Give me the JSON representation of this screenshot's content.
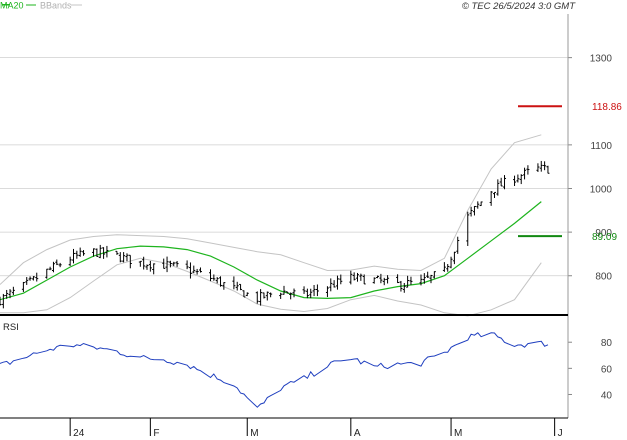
{
  "header": {
    "legend_ma": "MA20",
    "legend_bbands": "BBands",
    "copyright": "© TEC 26/5/2024 3:0 GMT"
  },
  "colors": {
    "background": "#ffffff",
    "grid": "#cfcfcf",
    "price": "#000000",
    "ma20": "#1eb41e",
    "bbands": "#c4c4c4",
    "rsi": "#1f3fbf",
    "resistance": "#cc1111",
    "support": "#118811"
  },
  "chart_data": [
    {
      "type": "ohlc",
      "title": "",
      "y_ticks": [
        {
          "value": 130,
          "label": "1300"
        },
        {
          "value": 110,
          "label": "1100"
        },
        {
          "value": 100,
          "label": "1000"
        },
        {
          "value": 90,
          "label": "900"
        },
        {
          "value": 80,
          "label": "800"
        }
      ],
      "ylim": [
        71,
        140
      ],
      "x_ticks": [
        {
          "date": "2024-01-08",
          "label": "24"
        },
        {
          "date": "2024-02-01",
          "label": "F"
        },
        {
          "date": "2024-03-01",
          "label": "M"
        },
        {
          "date": "2024-04-01",
          "label": "A"
        },
        {
          "date": "2024-05-01",
          "label": "M"
        },
        {
          "date": "2024-06-01",
          "label": "J"
        }
      ],
      "x_range": [
        "2023-12-18",
        "2024-06-05"
      ],
      "grid": "horizontal",
      "legend": "top-left",
      "series": [
        {
          "name": "MA20",
          "kind": "line",
          "color": "#1eb41e",
          "points": [
            [
              "2023-12-18",
              74.5
            ],
            [
              "2023-12-25",
              76
            ],
            [
              "2024-01-01",
              79
            ],
            [
              "2024-01-08",
              82
            ],
            [
              "2024-01-15",
              84.5
            ],
            [
              "2024-01-22",
              86.2
            ],
            [
              "2024-01-29",
              86.8
            ],
            [
              "2024-02-05",
              86.6
            ],
            [
              "2024-02-12",
              86
            ],
            [
              "2024-02-19",
              84.5
            ],
            [
              "2024-02-26",
              82
            ],
            [
              "2024-03-04",
              79
            ],
            [
              "2024-03-11",
              76.5
            ],
            [
              "2024-03-18",
              75
            ],
            [
              "2024-03-25",
              74.8
            ],
            [
              "2024-04-01",
              75
            ],
            [
              "2024-04-08",
              76.5
            ],
            [
              "2024-04-15",
              77.5
            ],
            [
              "2024-04-22",
              78.2
            ],
            [
              "2024-04-29",
              80
            ],
            [
              "2024-05-06",
              84
            ],
            [
              "2024-05-13",
              88
            ],
            [
              "2024-05-20",
              92
            ],
            [
              "2024-05-28",
              97
            ]
          ]
        },
        {
          "name": "BBands upper",
          "kind": "line",
          "color": "#c4c4c4",
          "points": [
            [
              "2023-12-18",
              78
            ],
            [
              "2023-12-25",
              83
            ],
            [
              "2024-01-01",
              86
            ],
            [
              "2024-01-08",
              88.2
            ],
            [
              "2024-01-15",
              89
            ],
            [
              "2024-01-22",
              89.4
            ],
            [
              "2024-01-29",
              89.2
            ],
            [
              "2024-02-05",
              89
            ],
            [
              "2024-02-12",
              88.5
            ],
            [
              "2024-02-19",
              87.5
            ],
            [
              "2024-02-26",
              86.5
            ],
            [
              "2024-03-04",
              85.5
            ],
            [
              "2024-03-11",
              84.8
            ],
            [
              "2024-03-18",
              83
            ],
            [
              "2024-03-25",
              81.2
            ],
            [
              "2024-04-01",
              81.3
            ],
            [
              "2024-04-08",
              82.2
            ],
            [
              "2024-04-15",
              81.5
            ],
            [
              "2024-04-22",
              81.2
            ],
            [
              "2024-04-29",
              84
            ],
            [
              "2024-05-06",
              95
            ],
            [
              "2024-05-13",
              104.5
            ],
            [
              "2024-05-20",
              110.5
            ],
            [
              "2024-05-28",
              112.3
            ]
          ]
        },
        {
          "name": "BBands lower",
          "kind": "line",
          "color": "#c4c4c4",
          "points": [
            [
              "2023-12-18",
              71.5
            ],
            [
              "2023-12-25",
              71.5
            ],
            [
              "2024-01-01",
              72.2
            ],
            [
              "2024-01-08",
              75
            ],
            [
              "2024-01-15",
              78.8
            ],
            [
              "2024-01-22",
              82.5
            ],
            [
              "2024-01-29",
              84
            ],
            [
              "2024-02-05",
              83
            ],
            [
              "2024-02-12",
              81
            ],
            [
              "2024-02-19",
              78.8
            ],
            [
              "2024-02-26",
              76.5
            ],
            [
              "2024-03-04",
              73.5
            ],
            [
              "2024-03-11",
              72.3
            ],
            [
              "2024-03-18",
              71.8
            ],
            [
              "2024-03-25",
              72.5
            ],
            [
              "2024-04-01",
              74.5
            ],
            [
              "2024-04-08",
              75.5
            ],
            [
              "2024-04-15",
              74.2
            ],
            [
              "2024-04-22",
              73.3
            ],
            [
              "2024-04-29",
              71.5
            ],
            [
              "2024-05-06",
              70.8
            ],
            [
              "2024-05-13",
              72.2
            ],
            [
              "2024-05-20",
              74.5
            ],
            [
              "2024-05-28",
              83
            ]
          ]
        },
        {
          "name": "Price",
          "kind": "ohlc",
          "color": "#000000",
          "points": [
            [
              "2023-12-18",
              74.5
            ],
            [
              "2023-12-25",
              77.5
            ],
            [
              "2024-01-01",
              81
            ],
            [
              "2024-01-08",
              84
            ],
            [
              "2024-01-15",
              85.5
            ],
            [
              "2024-01-22",
              84.5
            ],
            [
              "2024-01-29",
              83
            ],
            [
              "2024-02-05",
              82.5
            ],
            [
              "2024-02-12",
              81.5
            ],
            [
              "2024-02-19",
              79.5
            ],
            [
              "2024-02-26",
              77
            ],
            [
              "2024-03-04",
              74.8
            ],
            [
              "2024-03-11",
              76.5
            ],
            [
              "2024-03-18",
              75.5
            ],
            [
              "2024-03-25",
              77.5
            ],
            [
              "2024-04-01",
              79.5
            ],
            [
              "2024-04-08",
              79
            ],
            [
              "2024-04-15",
              78
            ],
            [
              "2024-04-22",
              78.5
            ],
            [
              "2024-04-29",
              81
            ],
            [
              "2024-05-06",
              93.5
            ],
            [
              "2024-05-13",
              99.5
            ],
            [
              "2024-05-20",
              102.5
            ],
            [
              "2024-05-27",
              104.5
            ]
          ]
        }
      ],
      "levels": [
        {
          "name": "resistance",
          "value": 118.86,
          "label": "118.86",
          "color": "#cc1111"
        },
        {
          "name": "support",
          "value": 89.09,
          "label": "89.09",
          "color": "#118811"
        }
      ]
    },
    {
      "type": "line",
      "title": "RSI",
      "y_ticks": [
        {
          "value": 80,
          "label": "80"
        },
        {
          "value": 60,
          "label": "60"
        },
        {
          "value": 40,
          "label": "40"
        }
      ],
      "ylim": [
        22,
        97
      ],
      "grid": "none",
      "series": [
        {
          "name": "RSI",
          "color": "#1f3fbf",
          "points": [
            [
              "2023-12-18",
              62
            ],
            [
              "2023-12-25",
              68
            ],
            [
              "2024-01-01",
              74
            ],
            [
              "2024-01-08",
              78
            ],
            [
              "2024-01-15",
              76
            ],
            [
              "2024-01-22",
              73
            ],
            [
              "2024-01-29",
              68
            ],
            [
              "2024-02-05",
              67
            ],
            [
              "2024-02-12",
              63
            ],
            [
              "2024-02-19",
              55
            ],
            [
              "2024-02-26",
              48
            ],
            [
              "2024-03-04",
              29
            ],
            [
              "2024-03-11",
              45
            ],
            [
              "2024-03-18",
              52
            ],
            [
              "2024-03-25",
              62
            ],
            [
              "2024-04-01",
              68
            ],
            [
              "2024-04-08",
              61
            ],
            [
              "2024-04-15",
              63
            ],
            [
              "2024-04-22",
              64
            ],
            [
              "2024-04-29",
              72
            ],
            [
              "2024-05-06",
              84
            ],
            [
              "2024-05-13",
              86
            ],
            [
              "2024-05-20",
              78
            ],
            [
              "2024-05-27",
              79
            ]
          ]
        }
      ]
    }
  ]
}
